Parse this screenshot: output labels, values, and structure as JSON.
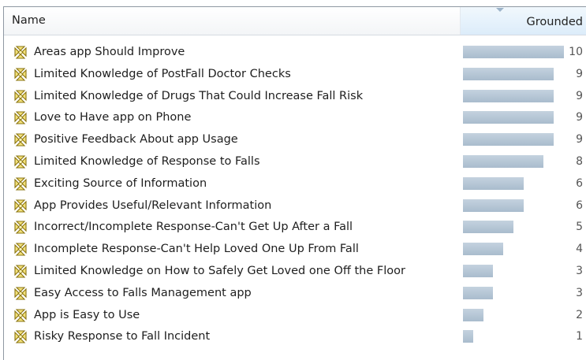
{
  "table": {
    "columns": {
      "name": "Name",
      "grounded": "Grounded"
    },
    "max_value": 10,
    "rows": [
      {
        "name": "Areas app Should Improve",
        "grounded": 10
      },
      {
        "name": "Limited Knowledge of PostFall Doctor Checks",
        "grounded": 9
      },
      {
        "name": "Limited Knowledge of Drugs That Could Increase Fall Risk",
        "grounded": 9
      },
      {
        "name": "Love to Have app on Phone",
        "grounded": 9
      },
      {
        "name": "Positive Feedback About app Usage",
        "grounded": 9
      },
      {
        "name": "Limited Knowledge of Response to Falls",
        "grounded": 8
      },
      {
        "name": "Exciting Source of Information",
        "grounded": 6
      },
      {
        "name": "App Provides Useful/Relevant Information",
        "grounded": 6
      },
      {
        "name": "Incorrect/Incomplete Response-Can't Get Up After a Fall",
        "grounded": 5
      },
      {
        "name": "Incomplete Response-Can't Help Loved One Up From Fall",
        "grounded": 4
      },
      {
        "name": "Limited Knowledge on How to Safely Get Loved one Off the Floor",
        "grounded": 3
      },
      {
        "name": "Easy Access to Falls Management app",
        "grounded": 3
      },
      {
        "name": "App is Easy to Use",
        "grounded": 2
      },
      {
        "name": "Risky Response to Fall Incident",
        "grounded": 1
      }
    ]
  },
  "icons": {
    "row_icon": "code-node-icon"
  },
  "colors": {
    "bar": "#b7c7d6",
    "sorted_header": "#dcecfa",
    "icon_fill": "#f4e27a",
    "icon_stroke": "#8a7410"
  }
}
